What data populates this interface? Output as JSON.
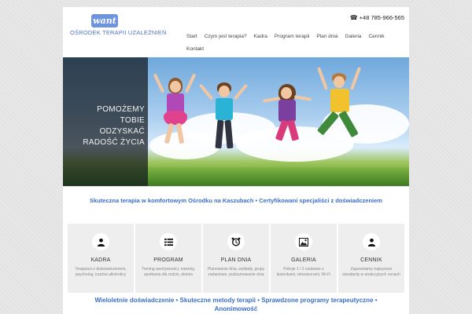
{
  "header": {
    "logo_text": "want",
    "site_name": "OŚRODEK TERAPII UZALEŻNIEŃ",
    "phone": "+48 785-966-565",
    "phone_icon": "phone-icon"
  },
  "nav": {
    "items": [
      {
        "label": "Start"
      },
      {
        "label": "Czym jest terapia?"
      },
      {
        "label": "Kadra"
      },
      {
        "label": "Program terapii"
      },
      {
        "label": "Plan dnia"
      },
      {
        "label": "Galeria"
      },
      {
        "label": "Cennik"
      },
      {
        "label": "Kontakt"
      }
    ]
  },
  "hero": {
    "line1": "POMOŻEMY",
    "line2": "TOBIE",
    "line3": "ODZYSKAĆ",
    "line4": "RADOŚĆ ŻYCIA"
  },
  "tagline": "Skuteczna terapia  w  komfortowym Ośrodku na Kaszubach  •  Certyfikowani specjaliści z doświadczeniem",
  "features": [
    {
      "title": "KADRA",
      "icon": "user-icon",
      "desc": "Terapeuci z doświadczeniem, psycholog, trzeźwi alkoholicy"
    },
    {
      "title": "PROGRAM",
      "icon": "list-icon",
      "desc": "Trening asertywności, nawroty, spotkania dla rodzin, detoks"
    },
    {
      "title": "PLAN DNIA",
      "icon": "alarm-clock-icon",
      "desc": "Planowanie dnia, wykłady, grupy zadaniowe, podsumowanie dnia"
    },
    {
      "title": "GALERIA",
      "icon": "image-icon",
      "desc": "Pokoje 1 i 2 osobowe z łazienkami, telewizorami, Wi-Fi"
    },
    {
      "title": "CENNIK",
      "icon": "user-icon",
      "desc": "Zapewniamy najwyższe standardy w atrakcyjnych cenach"
    }
  ],
  "bottom_tagline": "Wieloletnie doświadczenie  •  Skuteczne metody terapii  •  Sprawdzone programy terapeutyczne • Anonimowość",
  "colors": {
    "accent": "#3a6fc4",
    "logo": "#6e94dc",
    "feature_bg": "#eeeeee"
  }
}
